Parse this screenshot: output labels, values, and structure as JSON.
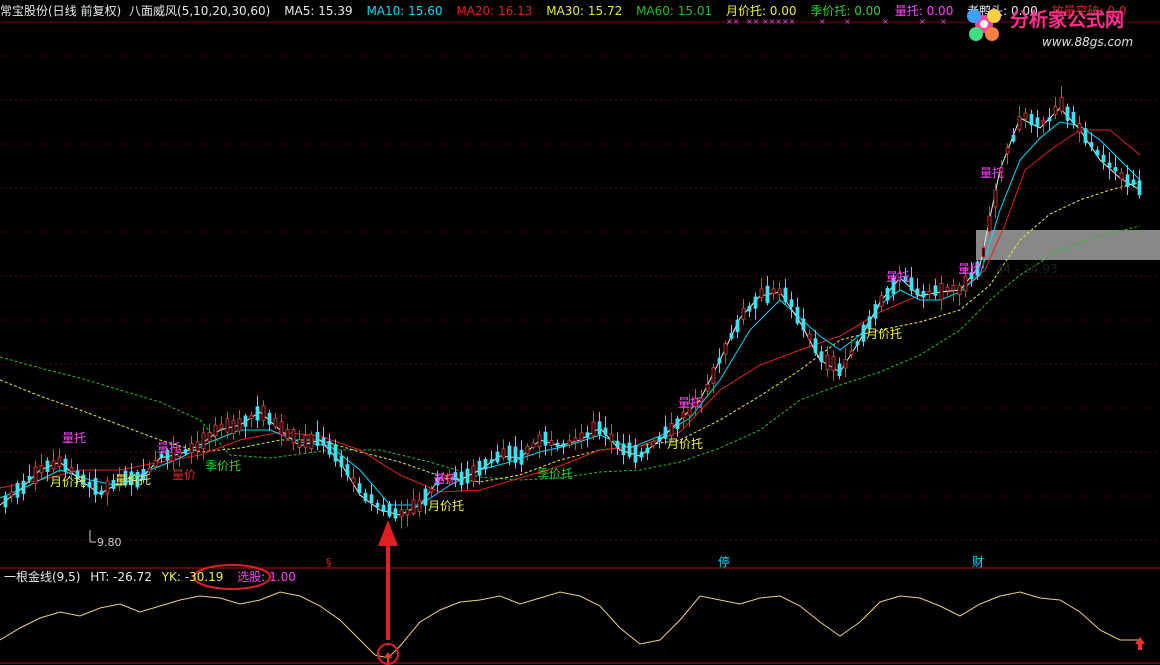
{
  "header": {
    "stock": "常宝股份(日线 前复权)",
    "indicator": "八面威风(5,10,20,30,60)",
    "ma5": "MA5: 15.39",
    "ma10": "MA10: 15.60",
    "ma20": "MA20: 16.13",
    "ma30": "MA30: 15.72",
    "ma60": "MA60: 15.01",
    "monthly_support": "月价托: 0.00",
    "season_support": "季价托: 0.00",
    "volume_support": "量托: 0.00",
    "duck_head": "老鸭头: 0.00",
    "volume_breakout": "放量突破: 0.0"
  },
  "colors": {
    "ma5": "#e8e8e8",
    "ma10": "#00d8ff",
    "ma20": "#e02020",
    "ma30": "#e8e840",
    "ma60": "#20c020",
    "up": "#e84040",
    "down": "#40e0f0",
    "magenta": "#ff40ff",
    "yellow": "#f0f040",
    "green": "#30d030"
  },
  "indicator_panel": {
    "name": "一根金线(9,5)",
    "ht": "HT: -26.72",
    "yk": "YK: -30.19",
    "select_label": "选股: 1.00"
  },
  "chart_data": {
    "type": "candlestick",
    "price_range": [
      9.5,
      25.5
    ],
    "low_label": "9.80",
    "range_label": "44 - 14.93",
    "event_markers": [
      "§",
      "停",
      "财"
    ],
    "annotations": [
      "量托",
      "月价托",
      "量托",
      "量价托",
      "季价托",
      "量价",
      "量托",
      "月价托",
      "季价托",
      "量托",
      "月价托",
      "量托",
      "月价托",
      "量托",
      "量价"
    ]
  },
  "logo": {
    "title": "分析家公式网",
    "url": "www.88gs.com"
  }
}
